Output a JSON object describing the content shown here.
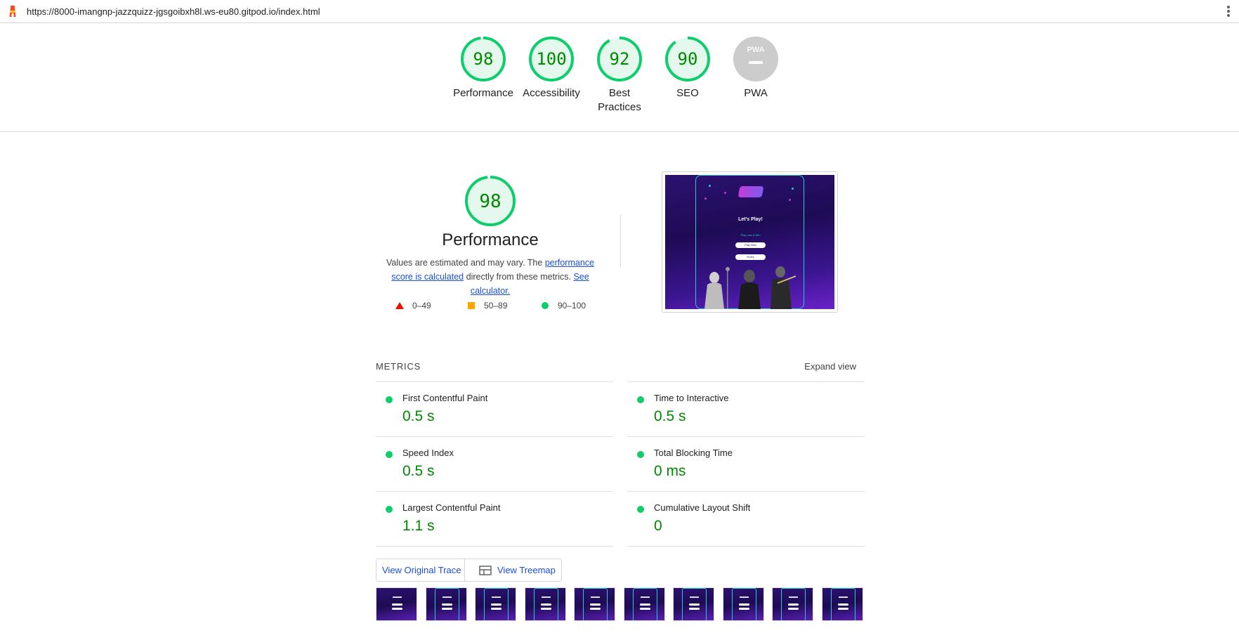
{
  "topbar": {
    "url": "https://8000-imangnp-jazzquizz-jgsgoibxh8l.ws-eu80.gitpod.io/index.html"
  },
  "colors": {
    "pass": "#0cce6b",
    "pass_text": "#008800",
    "pass_bg": "#e5f8ee",
    "pwa_gray": "#cccccc",
    "link": "#1a4fd6"
  },
  "summary": [
    {
      "score": "98",
      "label": "Performance"
    },
    {
      "score": "100",
      "label": "Accessibility"
    },
    {
      "score": "92",
      "label": "Best Practices"
    },
    {
      "score": "90",
      "label": "SEO"
    },
    {
      "score": "",
      "label": "PWA",
      "badge": "PWA"
    }
  ],
  "performance": {
    "score": "98",
    "title": "Performance",
    "desc_prefix": "Values are estimated and may vary. The ",
    "desc_link1": "performance score is calculated",
    "desc_mid": " directly from these metrics. ",
    "desc_link2": "See calculator.",
    "legend": [
      "0–49",
      "50–89",
      "90–100"
    ]
  },
  "screenshot": {
    "heading": "Let's Play!",
    "subtitle": "Play now & Win",
    "button1": "Play Now",
    "button2": "Rules"
  },
  "metrics": {
    "title": "METRICS",
    "expand": "Expand view",
    "items": [
      {
        "name": "First Contentful Paint",
        "value": "0.5 s"
      },
      {
        "name": "Time to Interactive",
        "value": "0.5 s"
      },
      {
        "name": "Speed Index",
        "value": "0.5 s"
      },
      {
        "name": "Total Blocking Time",
        "value": "0 ms"
      },
      {
        "name": "Largest Contentful Paint",
        "value": "1.1 s"
      },
      {
        "name": "Cumulative Layout Shift",
        "value": "0"
      }
    ]
  },
  "buttons": {
    "trace": "View Original Trace",
    "treemap": "View Treemap"
  },
  "filmstrip_count": 10
}
